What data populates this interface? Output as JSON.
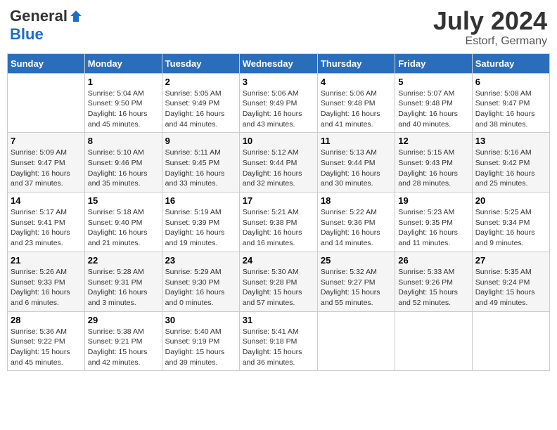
{
  "header": {
    "logo_general": "General",
    "logo_blue": "Blue",
    "month_year": "July 2024",
    "location": "Estorf, Germany"
  },
  "days_of_week": [
    "Sunday",
    "Monday",
    "Tuesday",
    "Wednesday",
    "Thursday",
    "Friday",
    "Saturday"
  ],
  "weeks": [
    [
      {
        "day": "",
        "sunrise": "",
        "sunset": "",
        "daylight": ""
      },
      {
        "day": "1",
        "sunrise": "Sunrise: 5:04 AM",
        "sunset": "Sunset: 9:50 PM",
        "daylight": "Daylight: 16 hours and 45 minutes."
      },
      {
        "day": "2",
        "sunrise": "Sunrise: 5:05 AM",
        "sunset": "Sunset: 9:49 PM",
        "daylight": "Daylight: 16 hours and 44 minutes."
      },
      {
        "day": "3",
        "sunrise": "Sunrise: 5:06 AM",
        "sunset": "Sunset: 9:49 PM",
        "daylight": "Daylight: 16 hours and 43 minutes."
      },
      {
        "day": "4",
        "sunrise": "Sunrise: 5:06 AM",
        "sunset": "Sunset: 9:48 PM",
        "daylight": "Daylight: 16 hours and 41 minutes."
      },
      {
        "day": "5",
        "sunrise": "Sunrise: 5:07 AM",
        "sunset": "Sunset: 9:48 PM",
        "daylight": "Daylight: 16 hours and 40 minutes."
      },
      {
        "day": "6",
        "sunrise": "Sunrise: 5:08 AM",
        "sunset": "Sunset: 9:47 PM",
        "daylight": "Daylight: 16 hours and 38 minutes."
      }
    ],
    [
      {
        "day": "7",
        "sunrise": "Sunrise: 5:09 AM",
        "sunset": "Sunset: 9:47 PM",
        "daylight": "Daylight: 16 hours and 37 minutes."
      },
      {
        "day": "8",
        "sunrise": "Sunrise: 5:10 AM",
        "sunset": "Sunset: 9:46 PM",
        "daylight": "Daylight: 16 hours and 35 minutes."
      },
      {
        "day": "9",
        "sunrise": "Sunrise: 5:11 AM",
        "sunset": "Sunset: 9:45 PM",
        "daylight": "Daylight: 16 hours and 33 minutes."
      },
      {
        "day": "10",
        "sunrise": "Sunrise: 5:12 AM",
        "sunset": "Sunset: 9:44 PM",
        "daylight": "Daylight: 16 hours and 32 minutes."
      },
      {
        "day": "11",
        "sunrise": "Sunrise: 5:13 AM",
        "sunset": "Sunset: 9:44 PM",
        "daylight": "Daylight: 16 hours and 30 minutes."
      },
      {
        "day": "12",
        "sunrise": "Sunrise: 5:15 AM",
        "sunset": "Sunset: 9:43 PM",
        "daylight": "Daylight: 16 hours and 28 minutes."
      },
      {
        "day": "13",
        "sunrise": "Sunrise: 5:16 AM",
        "sunset": "Sunset: 9:42 PM",
        "daylight": "Daylight: 16 hours and 25 minutes."
      }
    ],
    [
      {
        "day": "14",
        "sunrise": "Sunrise: 5:17 AM",
        "sunset": "Sunset: 9:41 PM",
        "daylight": "Daylight: 16 hours and 23 minutes."
      },
      {
        "day": "15",
        "sunrise": "Sunrise: 5:18 AM",
        "sunset": "Sunset: 9:40 PM",
        "daylight": "Daylight: 16 hours and 21 minutes."
      },
      {
        "day": "16",
        "sunrise": "Sunrise: 5:19 AM",
        "sunset": "Sunset: 9:39 PM",
        "daylight": "Daylight: 16 hours and 19 minutes."
      },
      {
        "day": "17",
        "sunrise": "Sunrise: 5:21 AM",
        "sunset": "Sunset: 9:38 PM",
        "daylight": "Daylight: 16 hours and 16 minutes."
      },
      {
        "day": "18",
        "sunrise": "Sunrise: 5:22 AM",
        "sunset": "Sunset: 9:36 PM",
        "daylight": "Daylight: 16 hours and 14 minutes."
      },
      {
        "day": "19",
        "sunrise": "Sunrise: 5:23 AM",
        "sunset": "Sunset: 9:35 PM",
        "daylight": "Daylight: 16 hours and 11 minutes."
      },
      {
        "day": "20",
        "sunrise": "Sunrise: 5:25 AM",
        "sunset": "Sunset: 9:34 PM",
        "daylight": "Daylight: 16 hours and 9 minutes."
      }
    ],
    [
      {
        "day": "21",
        "sunrise": "Sunrise: 5:26 AM",
        "sunset": "Sunset: 9:33 PM",
        "daylight": "Daylight: 16 hours and 6 minutes."
      },
      {
        "day": "22",
        "sunrise": "Sunrise: 5:28 AM",
        "sunset": "Sunset: 9:31 PM",
        "daylight": "Daylight: 16 hours and 3 minutes."
      },
      {
        "day": "23",
        "sunrise": "Sunrise: 5:29 AM",
        "sunset": "Sunset: 9:30 PM",
        "daylight": "Daylight: 16 hours and 0 minutes."
      },
      {
        "day": "24",
        "sunrise": "Sunrise: 5:30 AM",
        "sunset": "Sunset: 9:28 PM",
        "daylight": "Daylight: 15 hours and 57 minutes."
      },
      {
        "day": "25",
        "sunrise": "Sunrise: 5:32 AM",
        "sunset": "Sunset: 9:27 PM",
        "daylight": "Daylight: 15 hours and 55 minutes."
      },
      {
        "day": "26",
        "sunrise": "Sunrise: 5:33 AM",
        "sunset": "Sunset: 9:26 PM",
        "daylight": "Daylight: 15 hours and 52 minutes."
      },
      {
        "day": "27",
        "sunrise": "Sunrise: 5:35 AM",
        "sunset": "Sunset: 9:24 PM",
        "daylight": "Daylight: 15 hours and 49 minutes."
      }
    ],
    [
      {
        "day": "28",
        "sunrise": "Sunrise: 5:36 AM",
        "sunset": "Sunset: 9:22 PM",
        "daylight": "Daylight: 15 hours and 45 minutes."
      },
      {
        "day": "29",
        "sunrise": "Sunrise: 5:38 AM",
        "sunset": "Sunset: 9:21 PM",
        "daylight": "Daylight: 15 hours and 42 minutes."
      },
      {
        "day": "30",
        "sunrise": "Sunrise: 5:40 AM",
        "sunset": "Sunset: 9:19 PM",
        "daylight": "Daylight: 15 hours and 39 minutes."
      },
      {
        "day": "31",
        "sunrise": "Sunrise: 5:41 AM",
        "sunset": "Sunset: 9:18 PM",
        "daylight": "Daylight: 15 hours and 36 minutes."
      },
      {
        "day": "",
        "sunrise": "",
        "sunset": "",
        "daylight": ""
      },
      {
        "day": "",
        "sunrise": "",
        "sunset": "",
        "daylight": ""
      },
      {
        "day": "",
        "sunrise": "",
        "sunset": "",
        "daylight": ""
      }
    ]
  ]
}
